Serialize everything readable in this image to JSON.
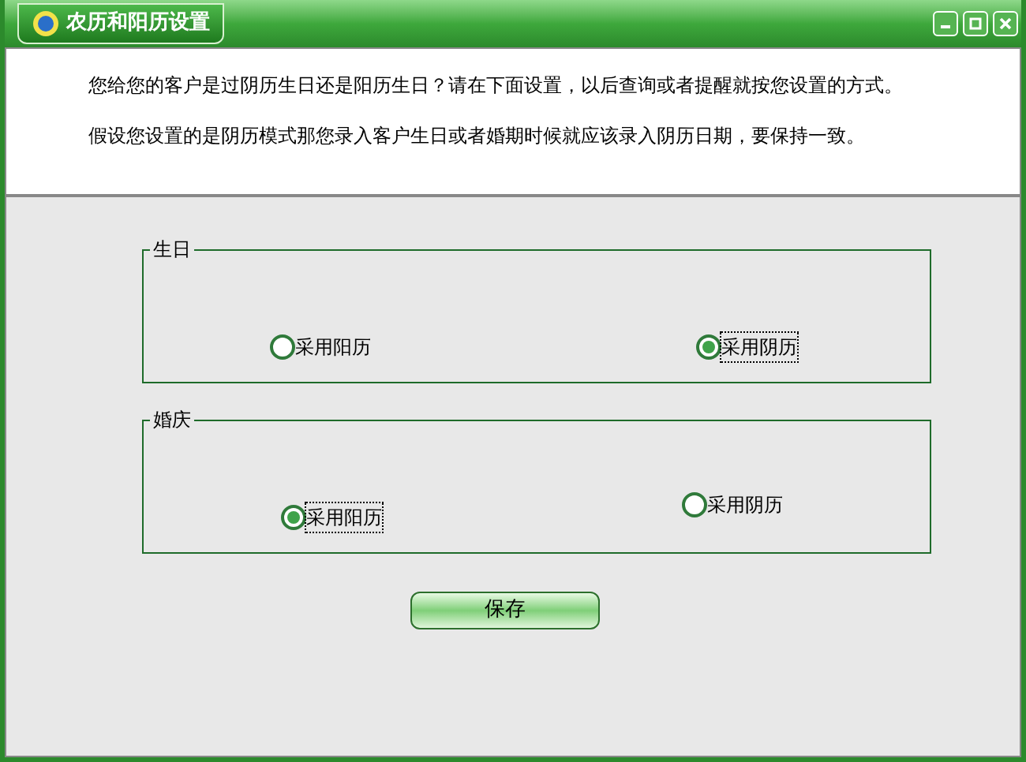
{
  "window": {
    "title": "农历和阳历设置"
  },
  "info": [
    "您给您的客户是过阴历生日还是阳历生日？请在下面设置，以后查询或者提醒就按您设置的方式。",
    "假设您设置的是阴历模式那您录入客户生日或者婚期时候就应该录入阴历日期，要保持一致。"
  ],
  "groups": [
    {
      "title": "生日",
      "options": [
        {
          "label": "采用阳历",
          "selected": false
        },
        {
          "label": "采用阴历",
          "selected": true
        }
      ]
    },
    {
      "title": "婚庆",
      "options": [
        {
          "label": "采用阳历",
          "selected": true
        },
        {
          "label": "采用阴历",
          "selected": false
        }
      ]
    }
  ],
  "save_button": "保存"
}
